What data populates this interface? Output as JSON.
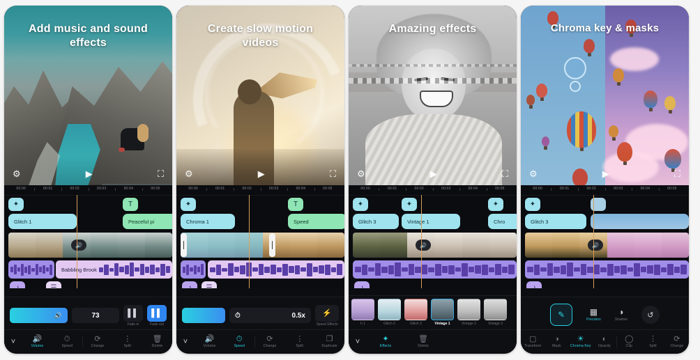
{
  "panels": [
    {
      "id": "add-music",
      "title": "Add music and sound effects",
      "preview_controls": {
        "settings": "gear-icon",
        "play": "play-icon",
        "fullscreen": "fullscreen-icon"
      },
      "ruler": [
        "00:00",
        "00:01",
        "00:02",
        "00:03",
        "00:04",
        "00:05"
      ],
      "clips": [
        {
          "label": "Glitch 1",
          "color": "cyan"
        },
        {
          "label": "Peaceful pi",
          "color": "green"
        }
      ],
      "badges": [
        "magic-wand-icon",
        "text-icon"
      ],
      "audio_label": "Babbling Brook",
      "track_badges": [
        "music-note-icon",
        "audio-levels-icon"
      ],
      "controls": {
        "slider_icon": "volume-icon",
        "value": "73",
        "fade_in_label": "Fade in",
        "fade_out_label": "Fade out"
      },
      "nav": [
        {
          "label": "Volume",
          "icon": "volume-icon",
          "active": true
        },
        {
          "label": "Speed",
          "icon": "speedometer-icon",
          "active": false
        },
        {
          "label": "Change",
          "icon": "swap-icon",
          "active": false
        },
        {
          "label": "Split",
          "icon": "split-icon",
          "active": false
        },
        {
          "label": "Delete",
          "icon": "trash-icon",
          "active": false
        }
      ]
    },
    {
      "id": "slow-motion",
      "title": "Create slow motion videos",
      "preview_controls": {
        "settings": "gear-icon",
        "play": "play-icon",
        "fullscreen": "fullscreen-icon"
      },
      "ruler": [
        "00:00",
        "00:01",
        "00:02",
        "00:03",
        "00:04",
        "00:05"
      ],
      "clips": [
        {
          "label": "Chroma 1",
          "color": "cyan"
        },
        {
          "label": "Speed",
          "color": "green"
        }
      ],
      "badges": [
        "magic-wand-icon",
        "text-icon"
      ],
      "track_badges": [
        "music-note-icon",
        "audio-levels-icon"
      ],
      "controls": {
        "speed_icon": "speed-dial-icon",
        "value": "0.5x",
        "speed_effects_label": "Speed Effects",
        "speed_effects_icon": "flash-icon"
      },
      "nav": [
        {
          "label": "Volume",
          "icon": "volume-icon",
          "active": false
        },
        {
          "label": "Speed",
          "icon": "speedometer-icon",
          "active": true
        },
        {
          "label": "Change",
          "icon": "swap-icon",
          "active": false
        },
        {
          "label": "Split",
          "icon": "split-icon",
          "active": false
        },
        {
          "label": "Duplicate",
          "icon": "duplicate-icon",
          "active": false
        }
      ]
    },
    {
      "id": "amazing-effects",
      "title": "Amazing effects",
      "preview_controls": {
        "settings": "gear-icon",
        "play": "play-icon",
        "fullscreen": "fullscreen-icon"
      },
      "ruler": [
        "00:00",
        "00:01",
        "00:02",
        "00:03",
        "00:04",
        "00:05"
      ],
      "clips": [
        {
          "label": "Glitch 3",
          "color": "cyan"
        },
        {
          "label": "Vintage 1",
          "color": "cyan"
        },
        {
          "label": "Chro",
          "color": "cyan"
        }
      ],
      "badges": [
        "magic-wand-icon",
        "magic-wand-icon",
        "magic-wand-icon"
      ],
      "track_badges": [
        "music-note-icon"
      ],
      "effects": [
        {
          "label": "h 1",
          "selected": false
        },
        {
          "label": "Glitch 2",
          "selected": false
        },
        {
          "label": "Glitch 3",
          "selected": false
        },
        {
          "label": "Vintage 1",
          "selected": true
        },
        {
          "label": "Vintage 2",
          "selected": false
        },
        {
          "label": "Vintage 3",
          "selected": false
        }
      ],
      "nav": [
        {
          "label": "Effects",
          "icon": "magic-wand-icon",
          "active": true
        },
        {
          "label": "Delete",
          "icon": "trash-icon",
          "active": false
        }
      ]
    },
    {
      "id": "chroma-key",
      "title": "Chroma key & masks",
      "preview_controls": {
        "settings": "gear-icon",
        "play": "play-icon",
        "fullscreen": "fullscreen-icon"
      },
      "ruler": [
        "00:00",
        "00:01",
        "00:02",
        "00:03",
        "00:04",
        "00:05"
      ],
      "clips": [
        {
          "label": "Glitch 3",
          "color": "cyan"
        }
      ],
      "badges": [
        "magic-wand-icon",
        "thumbnail-icon"
      ],
      "track_badges": [
        "music-note-icon",
        "person-icon"
      ],
      "chroma_controls": {
        "picker_icon": "eyedropper-icon",
        "precision_label": "Precision",
        "precision_icon": "precision-icon",
        "shadow_label": "Shadow",
        "shadow_icon": "contrast-icon",
        "reset_icon": "reset-icon"
      },
      "nav": [
        {
          "label": "Transform",
          "icon": "transform-icon",
          "active": false
        },
        {
          "label": "Mask",
          "icon": "mask-icon",
          "active": false
        },
        {
          "label": "Chroma Key",
          "icon": "chroma-icon",
          "active": true
        },
        {
          "label": "Opacity",
          "icon": "opacity-icon",
          "active": false
        },
        {
          "label": "Clip",
          "icon": "clip-icon",
          "active": false
        },
        {
          "label": "Split",
          "icon": "split-icon",
          "active": false
        },
        {
          "label": "Change",
          "icon": "swap-icon",
          "active": false
        }
      ]
    }
  ],
  "colors": {
    "accent_cyan": "#2ad0e0",
    "clip_cyan": "#9fe3ee",
    "clip_green": "#8fe6b4",
    "audio_purple": "#b9a3ef",
    "playhead": "#d9a05a",
    "panel_bg": "#0b0c10"
  }
}
